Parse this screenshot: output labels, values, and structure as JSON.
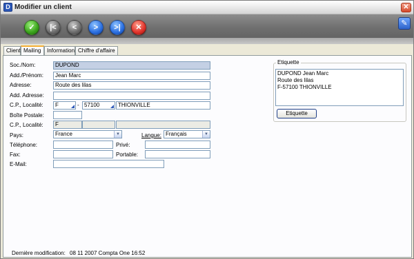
{
  "window": {
    "title": "Modifier un client",
    "app_icon": "D",
    "close_symbol": "✕"
  },
  "toolbar": {
    "buttons": [
      {
        "icon": "checkmark-icon",
        "symbol": "✓",
        "color": "#3aa21b"
      },
      {
        "icon": "first-record-icon",
        "symbol": "|<",
        "color": "#6b6b6b"
      },
      {
        "icon": "previous-icon",
        "symbol": "<",
        "color": "#6b6b6b"
      },
      {
        "icon": "next-icon",
        "symbol": ">",
        "color": "#2a6ee0"
      },
      {
        "icon": "last-record-icon",
        "symbol": ">|",
        "color": "#2a6ee0"
      },
      {
        "icon": "cancel-icon",
        "symbol": "✕",
        "color": "#e0322a"
      }
    ],
    "tool_icon_symbol": "✎"
  },
  "tabs": [
    "Client",
    "Mailing",
    "Information",
    "Chiffre d'affaire"
  ],
  "active_tab": "Mailing",
  "form": {
    "soc_nom_label": "Soc./Nom:",
    "soc_nom_value": "DUPOND",
    "add_prenom_label": "Add./Prénom:",
    "add_prenom_value": "Jean Marc",
    "adresse_label": "Adresse:",
    "adresse_value": "Route des lilas",
    "add_adresse_label": "Add. Adresse:",
    "add_adresse_value": "",
    "cp_localite_label": "C.P., Localité:",
    "cp_country": "F",
    "cp_dash": "-",
    "cp_code": "57100",
    "cp_city": "THIONVILLE",
    "boite_postale_label": "Boîte Postale:",
    "boite_postale_value": "",
    "cp_localite2_label": "C.P., Localité:",
    "cp2_country": "F",
    "cp2_code": "",
    "cp2_city": "",
    "pays_label": "Pays:",
    "pays_value": "France",
    "langue_label": "Langue:",
    "langue_value": "Français",
    "telephone_label": "Téléphone:",
    "telephone_value": "",
    "prive_label": "Privé:",
    "prive_value": "",
    "fax_label": "Fax:",
    "fax_value": "",
    "portable_label": "Portable:",
    "portable_value": "",
    "email_label": "E-Mail:",
    "email_value": ""
  },
  "etiquette": {
    "group_title": "Etiquette",
    "lines": [
      "DUPOND Jean Marc",
      "Route des lilas",
      "F-57100 THIONVILLE"
    ],
    "button_label": "Etiquette"
  },
  "footer": {
    "label": "Dernière modification:",
    "value": "08 11 2007 Compta One 16:52"
  }
}
